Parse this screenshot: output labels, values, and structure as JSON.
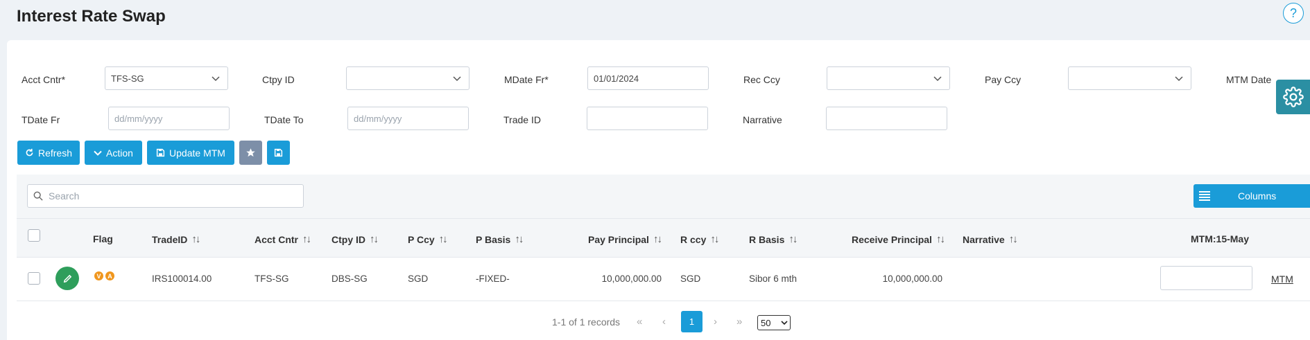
{
  "title": "Interest Rate Swap",
  "help_icon": "?",
  "filters": {
    "acct_cntr_label": "Acct Cntr*",
    "acct_cntr_value": "TFS-SG",
    "ctpy_id_label": "Ctpy ID",
    "ctpy_id_value": "",
    "mdate_fr_label": "MDate Fr*",
    "mdate_fr_value": "01/01/2024",
    "rec_ccy_label": "Rec Ccy",
    "rec_ccy_value": "",
    "pay_ccy_label": "Pay Ccy",
    "pay_ccy_value": "",
    "mtm_date_label": "MTM Date",
    "tdate_fr_label": "TDate Fr",
    "tdate_fr_placeholder": "dd/mm/yyyy",
    "tdate_to_label": "TDate To",
    "tdate_to_placeholder": "dd/mm/yyyy",
    "trade_id_label": "Trade ID",
    "trade_id_value": "",
    "narrative_label": "Narrative",
    "narrative_value": ""
  },
  "toolbar": {
    "refresh_label": "Refresh",
    "action_label": "Action",
    "update_mtm_label": "Update MTM",
    "favorite_icon": "star-icon",
    "save_icon": "floppy-disk-icon"
  },
  "grid": {
    "search_placeholder": "Search",
    "columns_label": "Columns",
    "headers": {
      "flag": "Flag",
      "trade_id": "TradeID",
      "acct_cntr": "Acct Cntr",
      "ctpy_id": "Ctpy ID",
      "p_ccy": "P Ccy",
      "p_basis": "P Basis",
      "pay_principal": "Pay Principal",
      "r_ccy": "R ccy",
      "r_basis": "R Basis",
      "receive_principal": "Receive Principal",
      "narrative": "Narrative",
      "mtm": "MTM:15-May"
    },
    "rows": [
      {
        "flags": [
          "V",
          "A"
        ],
        "trade_id": "IRS100014.00",
        "acct_cntr": "TFS-SG",
        "ctpy_id": "DBS-SG",
        "p_ccy": "SGD",
        "p_basis": "-FIXED-",
        "pay_principal": "10,000,000.00",
        "r_ccy": "SGD",
        "r_basis": "Sibor 6 mth",
        "receive_principal": "10,000,000.00",
        "narrative": "",
        "mtm_value": "",
        "mtm_link": "MTM"
      }
    ]
  },
  "pagination": {
    "summary": "1-1 of 1 records",
    "current_page": "1",
    "page_size": "50"
  },
  "colors": {
    "primary": "#1a9cd8",
    "edit_green": "#2e9e5b",
    "flag_orange": "#f0961d",
    "settings_teal": "#2b8fa3"
  }
}
